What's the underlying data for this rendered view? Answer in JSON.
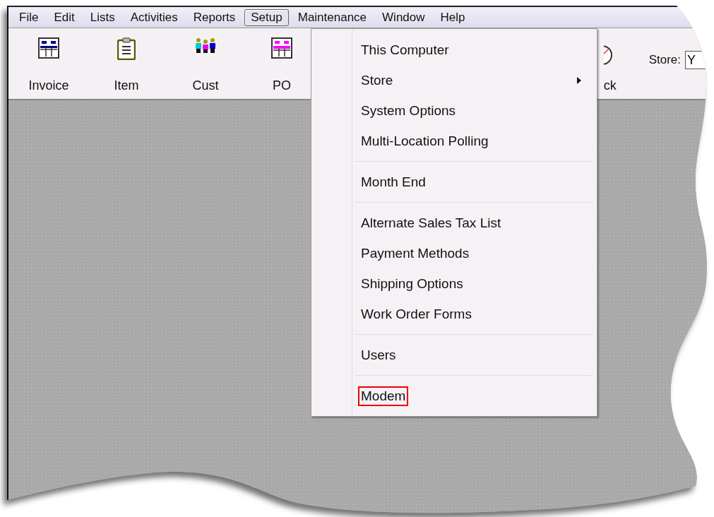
{
  "menu_bar": [
    {
      "label": "File",
      "selected": false
    },
    {
      "label": "Edit",
      "selected": false
    },
    {
      "label": "Lists",
      "selected": false
    },
    {
      "label": "Activities",
      "selected": false
    },
    {
      "label": "Reports",
      "selected": false
    },
    {
      "label": "Setup",
      "selected": true
    },
    {
      "label": "Maintenance",
      "selected": false
    },
    {
      "label": "Window",
      "selected": false
    },
    {
      "label": "Help",
      "selected": false
    }
  ],
  "toolbar": {
    "buttons": [
      {
        "kind": "invoice",
        "label": "Invoice"
      },
      {
        "kind": "item",
        "label": "Item"
      },
      {
        "kind": "customers",
        "label": "Cust"
      },
      {
        "kind": "po",
        "label": "PO"
      },
      {
        "kind": "clock",
        "label": "ck"
      }
    ],
    "store": {
      "label": "Store:",
      "value": "Y"
    }
  },
  "setup_menu": {
    "groups": [
      [
        {
          "label": "This Computer",
          "submenu": false,
          "highlighted": false
        },
        {
          "label": "Store",
          "submenu": true,
          "highlighted": false
        },
        {
          "label": "System Options",
          "submenu": false,
          "highlighted": false
        },
        {
          "label": "Multi-Location Polling",
          "submenu": false,
          "highlighted": false
        }
      ],
      [
        {
          "label": "Month End",
          "submenu": false,
          "highlighted": false
        }
      ],
      [
        {
          "label": "Alternate Sales Tax List",
          "submenu": false,
          "highlighted": false
        },
        {
          "label": "Payment Methods",
          "submenu": false,
          "highlighted": false
        },
        {
          "label": "Shipping Options",
          "submenu": false,
          "highlighted": false
        },
        {
          "label": "Work Order Forms",
          "submenu": false,
          "highlighted": false
        }
      ],
      [
        {
          "label": "Users",
          "submenu": false,
          "highlighted": false
        }
      ],
      [
        {
          "label": "Modem",
          "submenu": false,
          "highlighted": true
        }
      ]
    ]
  }
}
